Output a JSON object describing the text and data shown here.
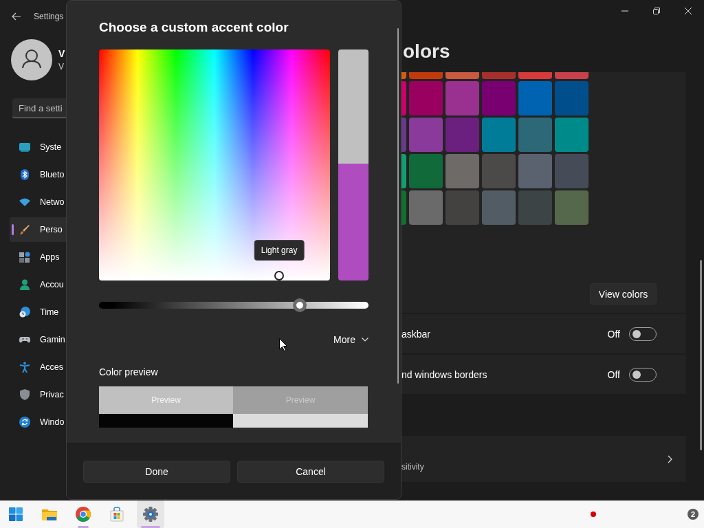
{
  "settings_window": {
    "title": "Settings",
    "user": {
      "name": "V",
      "email": "V"
    },
    "search": {
      "placeholder": "Find a setti"
    },
    "nav_items": [
      {
        "label": "Syste",
        "selected": false
      },
      {
        "label": "Blueto",
        "selected": false
      },
      {
        "label": "Netwo",
        "selected": false
      },
      {
        "label": "Perso",
        "selected": true
      },
      {
        "label": "Apps",
        "selected": false
      },
      {
        "label": "Accou",
        "selected": false
      },
      {
        "label": "Time",
        "selected": false
      },
      {
        "label": "Gamin",
        "selected": false
      },
      {
        "label": "Acces",
        "selected": false
      },
      {
        "label": "Privac",
        "selected": false
      },
      {
        "label": "Windo",
        "selected": false
      }
    ],
    "page_title": "olors",
    "accent_swatches": [
      [
        {
          "color": "#d06010"
        },
        {
          "color": "#c23a0c"
        },
        {
          "color": "#c85a40"
        },
        {
          "color": "#a8302c"
        },
        {
          "color": "#d83a3a"
        },
        {
          "color": "#c8404a"
        }
      ],
      [
        {
          "color": "#d0006a"
        },
        {
          "color": "#9a0060"
        },
        {
          "color": "#9a3090"
        },
        {
          "color": "#780070"
        },
        {
          "color": "#0063b1"
        },
        {
          "color": "#004e8c"
        }
      ],
      [
        {
          "color": "#6a3a8a"
        },
        {
          "color": "#8a3a9a"
        },
        {
          "color": "#6b1f7f"
        },
        {
          "color": "#007c99"
        },
        {
          "color": "#2d6878"
        },
        {
          "color": "#008b8b"
        }
      ],
      [
        {
          "color": "#10a070"
        },
        {
          "color": "#106a3a"
        },
        {
          "color": "#6e6a68"
        },
        {
          "color": "#4c4a48"
        },
        {
          "color": "#5a6270"
        },
        {
          "color": "#464b58"
        }
      ],
      [
        {
          "color": "#107030"
        },
        {
          "color": "#6a6a6a"
        },
        {
          "color": "#444240"
        },
        {
          "color": "#525c64"
        },
        {
          "color": "#3c4446"
        },
        {
          "color": "#56684c"
        }
      ]
    ],
    "view_colors_button": "View colors",
    "toggle_rows": [
      {
        "label": "askbar",
        "state_text": "Off",
        "on": false
      },
      {
        "label": "nd windows borders",
        "state_text": "Off",
        "on": false
      }
    ],
    "link_row": {
      "subtitle": "sitivity"
    }
  },
  "dialog": {
    "title": "Choose a custom accent color",
    "picker": {
      "level": 0.78
    },
    "picker_tooltip": "Light gray",
    "compare_swatches": [
      {
        "color": "#c0c0c0"
      },
      {
        "color": "#ae4cc0"
      }
    ],
    "brightness_slider": {
      "level": 0.745
    },
    "more_button": "More",
    "preview_heading": "Color preview",
    "preview_tiles": [
      {
        "label": "Preview",
        "color": "#c0c0c0"
      },
      {
        "label": "Preview",
        "color": "#9f9f9f"
      },
      {
        "color": "#050505"
      },
      {
        "color": "#dcdcdc"
      }
    ],
    "buttons": [
      {
        "label": "Done"
      },
      {
        "label": "Cancel"
      }
    ]
  },
  "taskbar": {
    "apps": [
      {
        "active": false,
        "running": false
      },
      {
        "active": false,
        "running": false
      },
      {
        "active": false,
        "running": true
      },
      {
        "active": false,
        "running": false
      },
      {
        "active": true,
        "running": true
      }
    ],
    "tray": {
      "badge": "2"
    }
  }
}
